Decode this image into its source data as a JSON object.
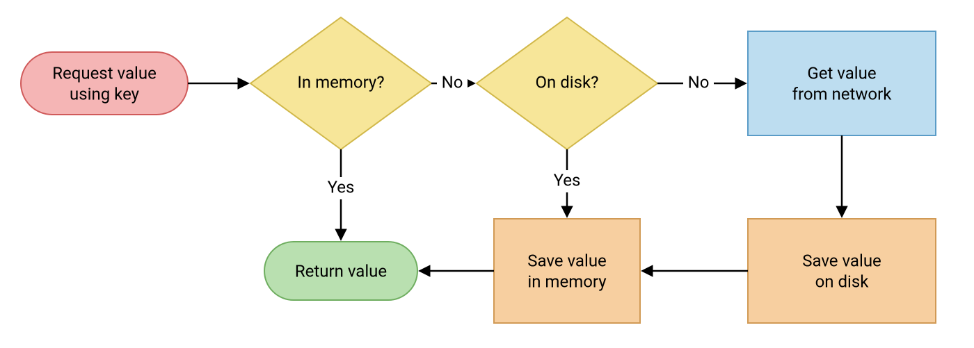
{
  "nodes": {
    "start": {
      "line1": "Request value",
      "line2": "using key"
    },
    "in_memory": {
      "label": "In memory?"
    },
    "on_disk": {
      "label": "On disk?"
    },
    "get_network": {
      "line1": "Get value",
      "line2": "from network"
    },
    "save_memory": {
      "line1": "Save value",
      "line2": "in memory"
    },
    "save_disk": {
      "line1": "Save value",
      "line2": "on disk"
    },
    "return": {
      "label": "Return value"
    }
  },
  "edge_labels": {
    "mem_no": "No",
    "mem_yes": "Yes",
    "disk_no": "No",
    "disk_yes": "Yes"
  },
  "colors": {
    "start_fill": "#f5b5b5",
    "start_stroke": "#d05a5a",
    "decision_fill": "#f7e699",
    "decision_stroke": "#d1b84a",
    "process_blue_fill": "#bdddf0",
    "process_blue_stroke": "#5a9cc7",
    "process_orange_fill": "#f7cfa0",
    "process_orange_stroke": "#d19a55",
    "return_fill": "#b9e0b0",
    "return_stroke": "#6fae60"
  }
}
